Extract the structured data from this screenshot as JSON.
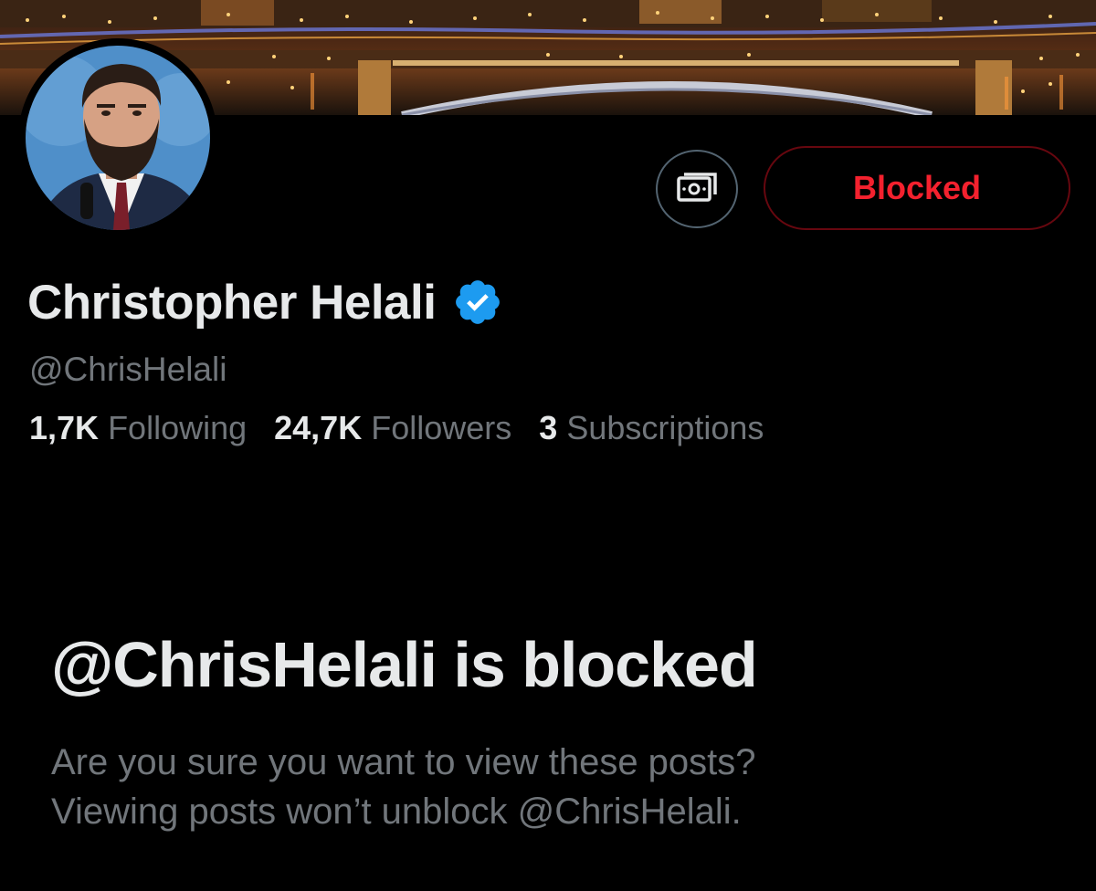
{
  "profile": {
    "display_name": "Christopher Helali",
    "handle": "@ChrisHelali",
    "verified_icon": "verified-badge-icon",
    "colors": {
      "verified": "#1d9bf0",
      "blocked": "#f4212e",
      "muted": "#71767b",
      "text": "#e7e9ea",
      "background": "#000000"
    }
  },
  "actions": {
    "subscribe_icon": "money-icon",
    "blocked_label": "Blocked"
  },
  "stats": {
    "following_count": "1,7K",
    "following_label": "Following",
    "followers_count": "24,7K",
    "followers_label": "Followers",
    "subscriptions_count": "3",
    "subscriptions_label": "Subscriptions"
  },
  "blocked_notice": {
    "title": "@ChrisHelali is blocked",
    "line1": "Are you sure you want to view these posts?",
    "line2": "Viewing posts won’t unblock @ChrisHelali."
  }
}
